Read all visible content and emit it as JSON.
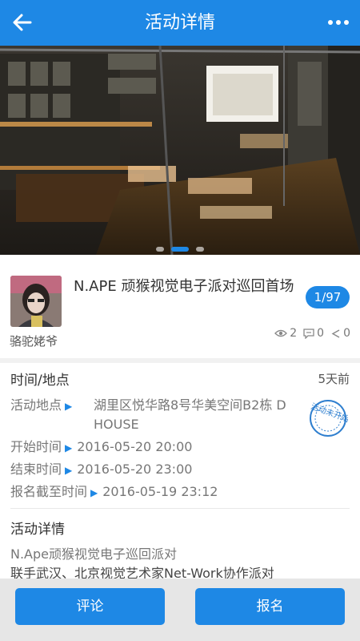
{
  "header": {
    "title": "活动详情",
    "back_icon": "back-arrow-icon",
    "more_icon": "more-dots-icon"
  },
  "banner": {
    "carousel_total": 3,
    "carousel_active": 2
  },
  "event": {
    "organizer": "骆驼姥爷",
    "title": "N.APE 顽猴视觉电子派对巡回首场",
    "page_badge": "1/97",
    "views": "2",
    "comments": "0",
    "shares": "0"
  },
  "time_location": {
    "heading": "时间/地点",
    "posted_ago": "5天前",
    "address_label": "活动地点",
    "address_value": "湖里区悦华路8号华美空间B2栋 D HOUSE",
    "start_label": "开始时间",
    "start_value": "2016-05-20 20:00",
    "end_label": "结束时间",
    "end_value": "2016-05-20 23:00",
    "deadline_label": "报名截至时间",
    "deadline_value": "2016-05-19 23:12",
    "status_stamp": "活动未开始"
  },
  "details": {
    "heading": "活动详情",
    "line1": "N.Ape顽猴视觉电子巡回派对",
    "line2": "联手武汉、北京视觉艺术家Net-Work协作派对"
  },
  "actions": {
    "comment_label": "评论",
    "signup_label": "报名"
  },
  "colors": {
    "brand": "#1e88e5",
    "bottom_bar": "#e6e6e6"
  }
}
